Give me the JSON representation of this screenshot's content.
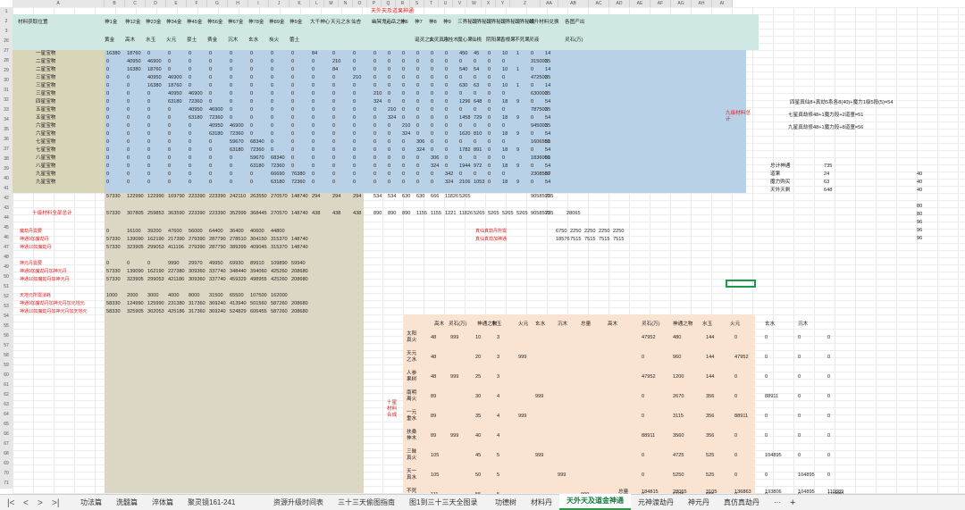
{
  "sheet": {
    "banner_title": "天外天及道果神通",
    "column_letters": [
      "A",
      "B",
      "C",
      "D",
      "E",
      "F",
      "G",
      "H",
      "I",
      "J",
      "K",
      "L",
      "M",
      "N",
      "O",
      "P",
      "Q",
      "R",
      "S",
      "T",
      "U",
      "V",
      "W",
      "X",
      "Y",
      "Z",
      "AA",
      "AB",
      "AC",
      "AD",
      "AE",
      "AF",
      "AG",
      "AH",
      "AI"
    ],
    "rows": [
      "1",
      "2",
      "3",
      "26",
      "27",
      "28",
      "29",
      "30",
      "31",
      "32",
      "33",
      "34",
      "35",
      "36",
      "37",
      "38",
      "39",
      "40",
      "41",
      "42",
      "43",
      "44",
      "45",
      "46",
      "47",
      "48",
      "49",
      "50",
      "51",
      "52",
      "53",
      "54",
      "55",
      "56",
      "57",
      "58",
      "59",
      "60",
      "61",
      "62",
      "63",
      "64",
      "65",
      "66",
      "67",
      "68",
      "69",
      "70",
      "71"
    ],
    "col_headers_row2": [
      "材料获取位置",
      "神1金",
      "神12金",
      "神23金",
      "神34金",
      "神45金",
      "神56金",
      "神67金",
      "神78金",
      "神89金",
      "神9金",
      "大千神心",
      "天元之水",
      "仙杏",
      "幽冥鬼心",
      "元岳之水",
      "神6",
      "神7",
      "神8",
      "神9",
      "三界秘境",
      "三界秘境",
      "三界秘境",
      "三界秘境",
      "三界秘境",
      "维升材料兑换",
      "",
      "各图产出"
    ],
    "col_headers_row3": [
      "",
      "黄金",
      "高木",
      "水玉",
      "火元",
      "豪土",
      "费金",
      "沉木",
      "玄水",
      "炭火",
      "蕾土",
      "",
      "",
      "",
      "",
      "",
      "",
      "诞灵之火",
      "玄灵真水",
      "月桂木",
      "魔心果",
      "仙桃",
      "阴阳果",
      "香根果",
      "不死果",
      "灵液",
      "",
      "灵石(万)"
    ],
    "left_labels": [
      "一星宝物",
      "二星宝物",
      "二星宝物",
      "三星宝物",
      "三星宝物",
      "三星宝物",
      "四星宝物",
      "五星宝物",
      "五星宝物",
      "六星宝物",
      "六星宝物",
      "七星宝物",
      "七星宝物",
      "八星宝物",
      "八星宝物",
      "九星宝物",
      "九星宝物"
    ],
    "data_rows": [
      [
        "16380",
        "18760",
        "0",
        "0",
        "0",
        "0",
        "0",
        "0",
        "0",
        "0",
        "84",
        "0",
        "0",
        "0",
        "0",
        "0",
        "0",
        "0",
        "0",
        "450",
        "45",
        "0",
        "10",
        "1",
        "0",
        "14"
      ],
      [
        "0",
        "40950",
        "46900",
        "0",
        "0",
        "0",
        "0",
        "0",
        "0",
        "0",
        "0",
        "210",
        "0",
        "0",
        "0",
        "0",
        "0",
        "0",
        "0",
        "0",
        "0",
        "0",
        "0",
        "",
        "315000",
        "35"
      ],
      [
        "0",
        "16380",
        "18760",
        "0",
        "0",
        "0",
        "0",
        "0",
        "0",
        "0",
        "0",
        "84",
        "0",
        "0",
        "0",
        "0",
        "0",
        "0",
        "0",
        "540",
        "54",
        "0",
        "10",
        "1",
        "0",
        "14"
      ],
      [
        "0",
        "0",
        "40950",
        "46900",
        "0",
        "0",
        "0",
        "0",
        "0",
        "0",
        "0",
        "0",
        "210",
        "0",
        "0",
        "0",
        "0",
        "0",
        "0",
        "0",
        "0",
        "0",
        "0",
        "",
        "472500",
        "35"
      ],
      [
        "0",
        "0",
        "16380",
        "18760",
        "0",
        "0",
        "0",
        "0",
        "0",
        "0",
        "0",
        "0",
        "0",
        "0",
        "0",
        "0",
        "0",
        "0",
        "0",
        "630",
        "63",
        "0",
        "10",
        "1",
        "0",
        "14"
      ],
      [
        "0",
        "0",
        "0",
        "40950",
        "46900",
        "0",
        "0",
        "0",
        "0",
        "0",
        "0",
        "0",
        "0",
        "210",
        "0",
        "0",
        "0",
        "0",
        "0",
        "0",
        "0",
        "0",
        "0",
        "",
        "630000",
        "35"
      ],
      [
        "0",
        "0",
        "0",
        "63180",
        "72360",
        "0",
        "0",
        "0",
        "0",
        "0",
        "0",
        "0",
        "0",
        "324",
        "0",
        "0",
        "0",
        "0",
        "0",
        "1296",
        "648",
        "0",
        "18",
        "9",
        "0",
        "54"
      ],
      [
        "0",
        "0",
        "0",
        "0",
        "40950",
        "46900",
        "0",
        "0",
        "0",
        "0",
        "0",
        "0",
        "0",
        "0",
        "210",
        "0",
        "0",
        "0",
        "0",
        "0",
        "0",
        "0",
        "0",
        "",
        "787500",
        "35"
      ],
      [
        "0",
        "0",
        "0",
        "0",
        "63180",
        "72360",
        "0",
        "0",
        "0",
        "0",
        "0",
        "0",
        "0",
        "0",
        "324",
        "0",
        "0",
        "0",
        "0",
        "1458",
        "729",
        "0",
        "18",
        "9",
        "0",
        "54"
      ],
      [
        "0",
        "0",
        "0",
        "0",
        "0",
        "40950",
        "46900",
        "0",
        "0",
        "0",
        "0",
        "0",
        "0",
        "0",
        "0",
        "210",
        "0",
        "0",
        "0",
        "0",
        "0",
        "0",
        "0",
        "",
        "945000",
        "35"
      ],
      [
        "0",
        "0",
        "0",
        "0",
        "0",
        "63180",
        "72360",
        "0",
        "0",
        "0",
        "0",
        "0",
        "0",
        "0",
        "0",
        "324",
        "0",
        "0",
        "0",
        "1620",
        "810",
        "0",
        "18",
        "9",
        "0",
        "54"
      ],
      [
        "0",
        "0",
        "0",
        "0",
        "0",
        "0",
        "59670",
        "68340",
        "0",
        "0",
        "0",
        "0",
        "0",
        "0",
        "0",
        "0",
        "306",
        "0",
        "0",
        "0",
        "0",
        "0",
        "0",
        "",
        "1606500",
        "51"
      ],
      [
        "0",
        "0",
        "0",
        "0",
        "0",
        "0",
        "63180",
        "72360",
        "0",
        "0",
        "0",
        "0",
        "0",
        "0",
        "0",
        "0",
        "324",
        "0",
        "0",
        "1782",
        "891",
        "0",
        "18",
        "9",
        "0",
        "54"
      ],
      [
        "0",
        "0",
        "0",
        "0",
        "0",
        "0",
        "0",
        "59670",
        "68340",
        "0",
        "0",
        "0",
        "0",
        "0",
        "0",
        "0",
        "0",
        "306",
        "0",
        "0",
        "0",
        "0",
        "0",
        "",
        "1836000",
        "51"
      ],
      [
        "0",
        "0",
        "0",
        "0",
        "0",
        "0",
        "0",
        "63180",
        "72360",
        "0",
        "0",
        "0",
        "0",
        "0",
        "0",
        "0",
        "0",
        "324",
        "0",
        "1944",
        "972",
        "0",
        "18",
        "9",
        "0",
        "54"
      ],
      [
        "0",
        "0",
        "0",
        "0",
        "0",
        "0",
        "0",
        "0",
        "66690",
        "76380",
        "0",
        "0",
        "0",
        "0",
        "0",
        "0",
        "0",
        "0",
        "342",
        "0",
        "0",
        "0",
        "0",
        "",
        "2308500",
        "57"
      ],
      [
        "0",
        "0",
        "0",
        "0",
        "0",
        "0",
        "0",
        "0",
        "63180",
        "72360",
        "0",
        "0",
        "0",
        "0",
        "0",
        "0",
        "0",
        "0",
        "324",
        "2106",
        "1053",
        "0",
        "18",
        "9",
        "0",
        "54"
      ]
    ],
    "sum_row": [
      "57330",
      "122990",
      "122990",
      "169790",
      "223390",
      "223390",
      "242110",
      "263550",
      "270570",
      "148740",
      "294",
      "294",
      "294",
      "534",
      "534",
      "630",
      "630",
      "666",
      "11826",
      "5265",
      "",
      "",
      "",
      "",
      "9058500",
      "735"
    ],
    "total_label": "十级材料全部总计",
    "total_row": [
      "57330",
      "307805",
      "259853",
      "363590",
      "223390",
      "223390",
      "352999",
      "368445",
      "270570",
      "148740",
      "438",
      "438",
      "438",
      "890",
      "890",
      "890",
      "1155",
      "1155",
      "1221",
      "11826",
      "5265",
      "5265",
      "5265",
      "5265",
      "9058500",
      "735",
      "28065"
    ],
    "lower_labels": [
      "魔劫丹需要",
      "神通9加魔劫丹",
      "神通10加魔劫丹",
      "",
      "神元丹需要",
      "神通9加魔劫丹加神元丹",
      "神通10加魔劫丹加神元丹",
      "",
      "天地元所需消耗",
      "神通9加魔劫丹加神元丹加元地元",
      "神通10加魔劫丹加神元丹加天地元"
    ],
    "lower_rows": [
      [
        "0",
        "16100",
        "39200",
        "47600",
        "56000",
        "64400",
        "36400",
        "40600",
        "44800",
        ""
      ],
      [
        "57330",
        "139090",
        "162190",
        "217390",
        "279390",
        "287790",
        "278510",
        "304150",
        "315370",
        "148740"
      ],
      [
        "57330",
        "323905",
        "299053",
        "411196",
        "279390",
        "287790",
        "389399",
        "409045",
        "315370",
        "148740"
      ],
      [
        "",
        "",
        "",
        "",
        "",
        "",
        "",
        "",
        "",
        ""
      ],
      [
        "0",
        "0",
        "0",
        "9990",
        "29970",
        "49950",
        "69930",
        "89910",
        "109890",
        "59940"
      ],
      [
        "57330",
        "139090",
        "162190",
        "227380",
        "309360",
        "337740",
        "348440",
        "394060",
        "425260",
        "208680"
      ],
      [
        "57330",
        "323905",
        "299053",
        "421186",
        "309360",
        "337740",
        "459329",
        "498955",
        "425260",
        "208680"
      ],
      [
        "",
        "",
        "",
        "",
        "",
        "",
        "",
        "",
        "",
        ""
      ],
      [
        "1000",
        "2000",
        "3000",
        "4000",
        "8000",
        "31500",
        "65500",
        "107500",
        "162000",
        ""
      ],
      [
        "58330",
        "124990",
        "125990",
        "231380",
        "317360",
        "369240",
        "413940",
        "501560",
        "587260",
        "208680"
      ],
      [
        "58330",
        "325905",
        "302053",
        "425186",
        "317360",
        "369240",
        "524829",
        "606455",
        "587260",
        "208680"
      ]
    ],
    "mid_labels": [
      "真仙真劫丹所需",
      "真仙真劫加神通"
    ],
    "mid_rows": [
      [
        "6750",
        "2250",
        "2250",
        "2250",
        "2250"
      ],
      [
        "18576",
        "7515",
        "7515",
        "7515",
        "7515"
      ]
    ],
    "side_note": "九级材料总计",
    "right_notes": [
      "四星真仙8+真劫5系各8(40)+魔力1级5段(5)=54",
      "七星真劫修48+1魔力段+2道童=51",
      "九星真劫修48+1魔力段+8道童=56"
    ],
    "right_stats": [
      {
        "label": "总计神通",
        "v1": "735",
        "v2": ""
      },
      {
        "label": "道果",
        "v1": "24",
        "v2": "40"
      },
      {
        "label": "魔力购买",
        "v1": "63",
        "v2": "40"
      },
      {
        "label": "天外天剩",
        "v1": "648",
        "v2": "40"
      }
    ],
    "right_col_values": [
      "80",
      "80",
      "96",
      "96",
      "96"
    ],
    "bottom_table": {
      "side_label": "十星材料合成",
      "headers": [
        "",
        "高木",
        "灵石(万)",
        "神通之物",
        "水玉",
        "火元",
        "玄水",
        "沉木",
        "总量",
        "高木",
        "灵石(万)",
        "神通之物",
        "水玉",
        "火元",
        "玄水",
        "沉木"
      ],
      "rows": [
        {
          "name": "太阳真火",
          "a": "48",
          "b": "999",
          "c": "10",
          "d": "3",
          "e": "",
          "f": "",
          "g": "",
          "h": "47952",
          "i": "480",
          "j": "144",
          "k": "0",
          "l": "0",
          "m": "0",
          "n": "0"
        },
        {
          "name": "天元之水",
          "a": "48",
          "b": "",
          "c": "20",
          "d": "3",
          "e": "999",
          "f": "",
          "g": "",
          "h": "0",
          "i": "960",
          "j": "144",
          "k": "47952",
          "l": "0",
          "m": "0",
          "n": "0"
        },
        {
          "name": "人参果树",
          "a": "48",
          "b": "999",
          "c": "25",
          "d": "3",
          "e": "",
          "f": "",
          "g": "",
          "h": "47952",
          "i": "1200",
          "j": "144",
          "k": "0",
          "l": "0",
          "m": "0",
          "n": "0"
        },
        {
          "name": "南明离火",
          "a": "89",
          "b": "",
          "c": "30",
          "d": "4",
          "e": "",
          "f": "999",
          "g": "",
          "h": "0",
          "i": "2670",
          "j": "356",
          "k": "0",
          "l": "88911",
          "m": "0",
          "n": "0"
        },
        {
          "name": "一元重水",
          "a": "89",
          "b": "",
          "c": "35",
          "d": "4",
          "e": "999",
          "f": "",
          "g": "",
          "h": "0",
          "i": "3115",
          "j": "356",
          "k": "88911",
          "l": "0",
          "m": "0",
          "n": "0"
        },
        {
          "name": "扶桑神木",
          "a": "89",
          "b": "999",
          "c": "40",
          "d": "4",
          "e": "",
          "f": "",
          "g": "",
          "h": "88911",
          "i": "3560",
          "j": "356",
          "k": "0",
          "l": "0",
          "m": "0",
          "n": "0"
        },
        {
          "name": "三昧真火",
          "a": "105",
          "b": "",
          "c": "45",
          "d": "5",
          "e": "",
          "f": "999",
          "g": "",
          "h": "0",
          "i": "4725",
          "j": "525",
          "k": "0",
          "l": "104895",
          "m": "0",
          "n": "0"
        },
        {
          "name": "天一真水",
          "a": "105",
          "b": "",
          "c": "50",
          "d": "5",
          "e": "",
          "f": "",
          "g": "999",
          "h": "0",
          "i": "5250",
          "j": "525",
          "k": "0",
          "l": "0",
          "m": "104895",
          "n": "0"
        },
        {
          "name": "不死树枝",
          "a": "111",
          "b": "",
          "c": "55",
          "d": "5",
          "e": "",
          "f": "",
          "g": "",
          "gg": "999",
          "h": "0",
          "i": "6105",
          "j": "555",
          "k": "0",
          "l": "0",
          "m": "0",
          "n": "110889"
        }
      ],
      "total_label": "总量",
      "total": [
        "184815",
        "28065",
        "3105",
        "136863",
        "193806",
        "104895",
        "110889"
      ]
    }
  },
  "tabs": {
    "items": [
      "功法篇",
      "洗髓篇",
      "淬体篇",
      "聚灵镜161-241",
      "资源升级时间表",
      "三十三天偷图指南",
      "图1到三十三天全图录",
      "功德树",
      "材料丹",
      "天外天及道金神通",
      "元神渡劫丹",
      "神元丹",
      "真仿真劫丹"
    ],
    "active_index": 9,
    "more": "···",
    "add": "+"
  },
  "colors": {
    "header_teal": "#cfe8e3",
    "data_blue": "#b9d1e6",
    "label_khaki": "#d9d5b9",
    "bottom_peach": "#fbe3d2",
    "tan": "#dcd7c4",
    "red": "#e02020",
    "active_tab": "#0f7a3c"
  }
}
